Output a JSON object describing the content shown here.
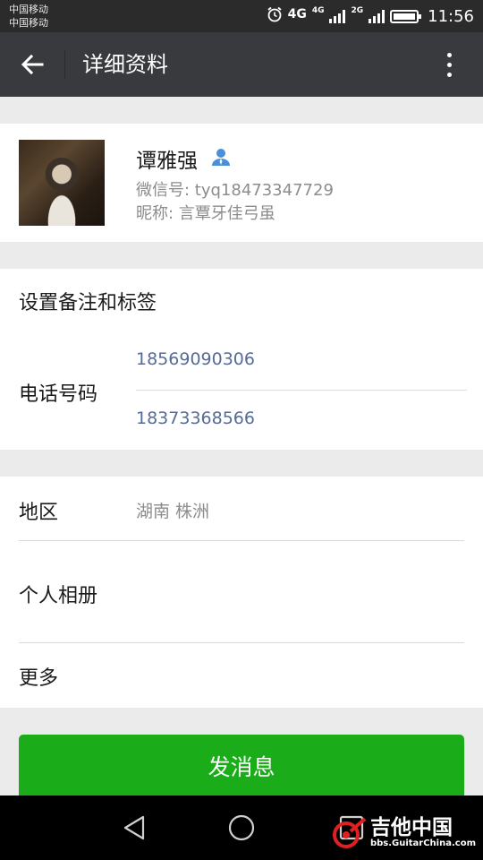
{
  "status_bar": {
    "carrier_1": "中国移动",
    "carrier_2": "中国移动",
    "network_1": "4G",
    "network_2": "4G",
    "network_3": "2G",
    "time": "11:56",
    "icons": [
      "alarm-icon",
      "signal-icon",
      "battery-icon"
    ]
  },
  "app_bar": {
    "title": "详细资料",
    "back_icon": "arrow-left-icon",
    "more_icon": "more-vertical-icon"
  },
  "profile": {
    "name": "谭雅强",
    "contact_icon": "person-icon",
    "wechat_id": "微信号: tyq18473347729",
    "nickname": "昵称: 言覃牙佳弓虽"
  },
  "remark": {
    "set_remark_label": "设置备注和标签",
    "phone_label": "电话号码",
    "phones": [
      "18569090306",
      "18373368566"
    ]
  },
  "info": {
    "region_label": "地区",
    "region_value": "湖南  株洲",
    "album_label": "个人相册",
    "more_label": "更多"
  },
  "actions": {
    "send_message": "发消息"
  },
  "watermark": {
    "text": "吉他中国",
    "sub": "bbs.GuitarChina.com"
  },
  "colors": {
    "app_bar": "#393a3e",
    "send_button": "#1aad19",
    "phone_link": "#576b95"
  }
}
